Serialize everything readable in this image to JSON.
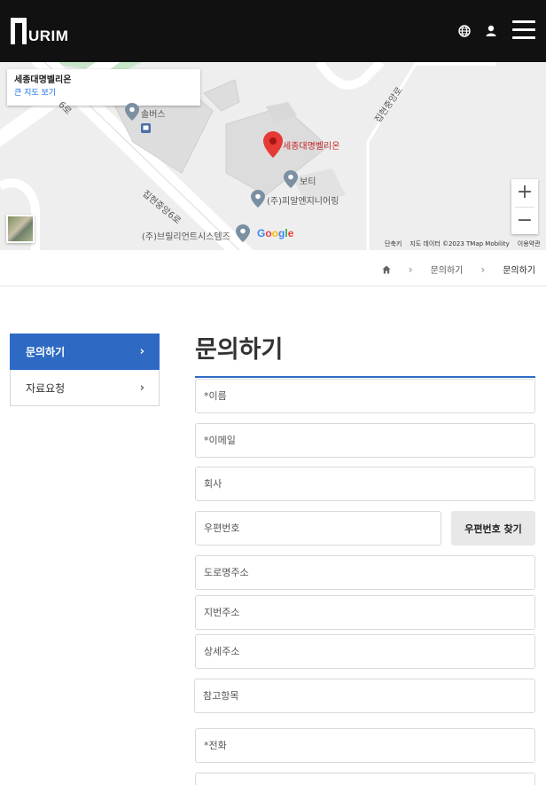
{
  "header": {
    "logo_text": "URIM",
    "icons": [
      "globe-icon",
      "user-icon",
      "hamburger-menu-icon"
    ]
  },
  "map": {
    "place_name": "세종대명벨리온",
    "larger_map_link": "큰 지도 보기",
    "pin_label": "세종대명벨리온",
    "labels": {
      "bus": "솔버스",
      "boti": "보티",
      "pial": "(주)피알엔지니어링",
      "brilliant": "(주)브릴리언트시스템즈",
      "road1": "집현중앙6로",
      "road2": "집현중앙로",
      "road3": "6로"
    },
    "google_logo": "Google",
    "footer": {
      "shortcuts": "단축키",
      "map_data": "지도 데이터 ©2023 TMap Mobility",
      "terms": "이용약관"
    },
    "zoom_in": "+",
    "zoom_out": "−"
  },
  "breadcrumb": {
    "items": [
      "문의하기",
      "문의하기"
    ]
  },
  "side_menu": {
    "items": [
      {
        "label": "문의하기",
        "active": true
      },
      {
        "label": "자료요청",
        "active": false
      }
    ],
    "chevron": "›"
  },
  "form": {
    "title": "문의하기",
    "name_placeholder": "*이름",
    "email_placeholder": "*이메일",
    "company_placeholder": "회사",
    "postal_placeholder": "우편번호",
    "postal_button": "우편번호 찾기",
    "road_address_placeholder": "도로명주소",
    "lot_address_placeholder": "지번주소",
    "detail_address_placeholder": "상세주소",
    "reference_placeholder": "참고항목",
    "phone_placeholder": "*전화"
  },
  "colors": {
    "header_bg": "#111111",
    "accent": "#2e6ac4",
    "pin": "#e53935"
  }
}
